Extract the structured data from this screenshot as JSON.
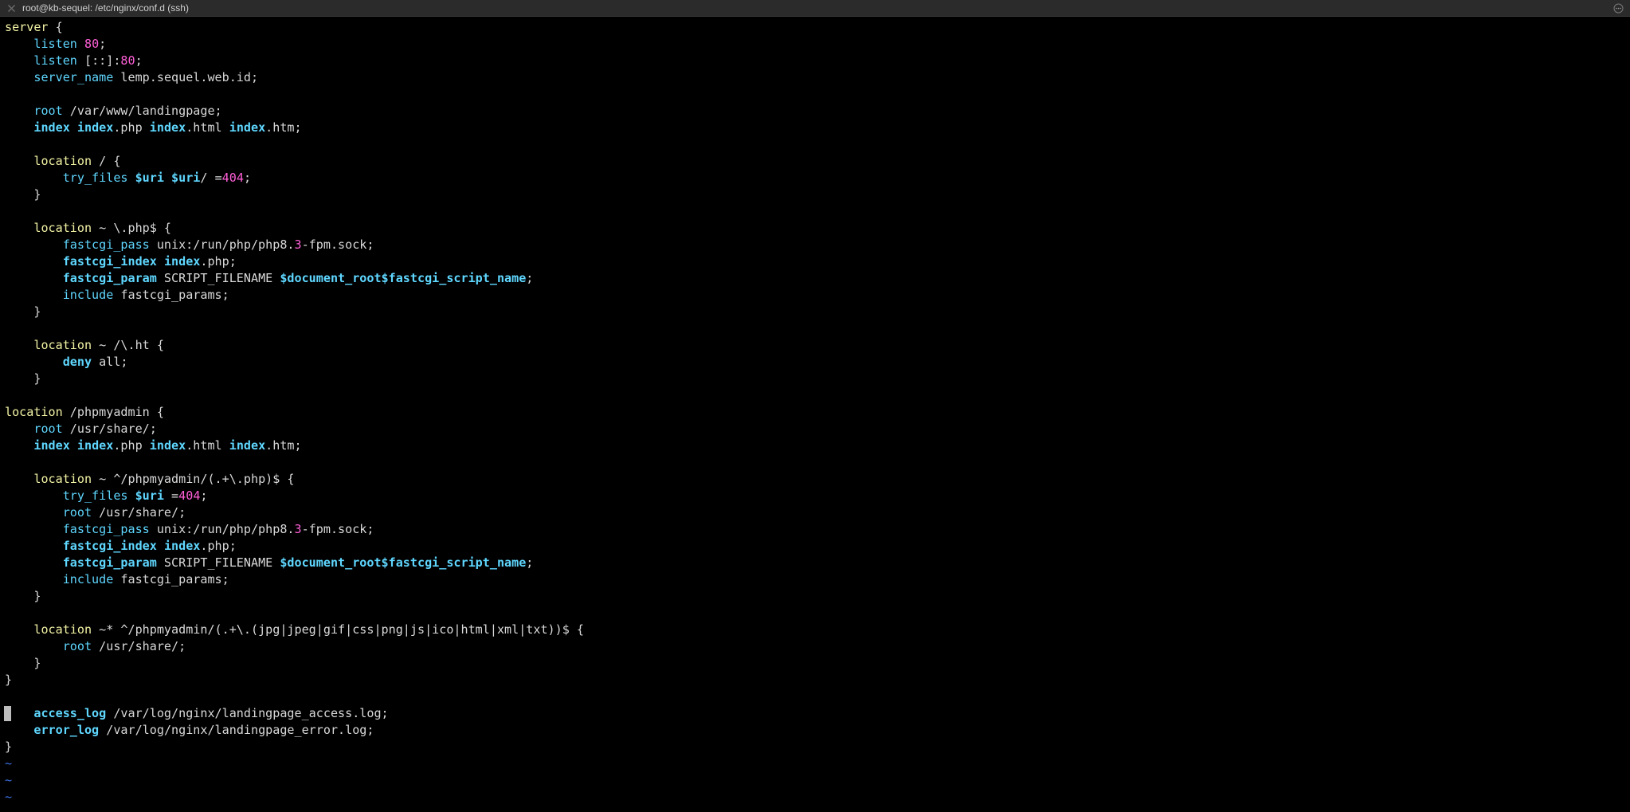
{
  "window": {
    "title": "root@kb-sequel: /etc/nginx/conf.d (ssh)"
  },
  "colors": {
    "background": "#000000",
    "block_keyword": "#f3f3a5",
    "directive": "#5fd7ff",
    "number": "#ff5fd7",
    "text": "#d9d9d9",
    "tilde": "#3a6fe0"
  },
  "cursor": {
    "line": 41,
    "column": 1
  },
  "lines": [
    [
      [
        "block",
        "server"
      ],
      [
        "plain",
        " {"
      ]
    ],
    [
      [
        "plain",
        "    "
      ],
      [
        "dir",
        "listen"
      ],
      [
        "plain",
        " "
      ],
      [
        "num",
        "80"
      ],
      [
        "plain",
        ";"
      ]
    ],
    [
      [
        "plain",
        "    "
      ],
      [
        "dir",
        "listen"
      ],
      [
        "plain",
        " [::]:"
      ],
      [
        "num",
        "80"
      ],
      [
        "plain",
        ";"
      ]
    ],
    [
      [
        "plain",
        "    "
      ],
      [
        "dir",
        "server_name"
      ],
      [
        "plain",
        " lemp.sequel.web.id;"
      ]
    ],
    [],
    [
      [
        "plain",
        "    "
      ],
      [
        "dir",
        "root"
      ],
      [
        "plain",
        " /var/www/landingpage;"
      ]
    ],
    [
      [
        "plain",
        "    "
      ],
      [
        "bdir",
        "index"
      ],
      [
        "plain",
        " "
      ],
      [
        "bdir",
        "index"
      ],
      [
        "plain",
        ".php "
      ],
      [
        "bdir",
        "index"
      ],
      [
        "plain",
        ".html "
      ],
      [
        "bdir",
        "index"
      ],
      [
        "plain",
        ".htm;"
      ]
    ],
    [],
    [
      [
        "plain",
        "    "
      ],
      [
        "block",
        "location"
      ],
      [
        "plain",
        " / {"
      ]
    ],
    [
      [
        "plain",
        "        "
      ],
      [
        "dir",
        "try_files"
      ],
      [
        "plain",
        " "
      ],
      [
        "var",
        "$uri"
      ],
      [
        "plain",
        " "
      ],
      [
        "var",
        "$uri"
      ],
      [
        "plain",
        "/ ="
      ],
      [
        "num",
        "404"
      ],
      [
        "plain",
        ";"
      ]
    ],
    [
      [
        "plain",
        "    }"
      ]
    ],
    [],
    [
      [
        "plain",
        "    "
      ],
      [
        "block",
        "location"
      ],
      [
        "plain",
        " ~ \\.php$ {"
      ]
    ],
    [
      [
        "plain",
        "        "
      ],
      [
        "dir",
        "fastcgi_pass"
      ],
      [
        "plain",
        " unix:/run/php/php8."
      ],
      [
        "num",
        "3"
      ],
      [
        "plain",
        "-fpm.sock;"
      ]
    ],
    [
      [
        "plain",
        "        "
      ],
      [
        "bdir",
        "fastcgi_index"
      ],
      [
        "plain",
        " "
      ],
      [
        "bdir",
        "index"
      ],
      [
        "plain",
        ".php;"
      ]
    ],
    [
      [
        "plain",
        "        "
      ],
      [
        "bdir",
        "fastcgi_param"
      ],
      [
        "plain",
        " SCRIPT_FILENAME "
      ],
      [
        "var",
        "$document_root$fastcgi_script_name"
      ],
      [
        "plain",
        ";"
      ]
    ],
    [
      [
        "plain",
        "        "
      ],
      [
        "dir",
        "include"
      ],
      [
        "plain",
        " fastcgi_params;"
      ]
    ],
    [
      [
        "plain",
        "    }"
      ]
    ],
    [],
    [
      [
        "plain",
        "    "
      ],
      [
        "block",
        "location"
      ],
      [
        "plain",
        " ~ /\\.ht {"
      ]
    ],
    [
      [
        "plain",
        "        "
      ],
      [
        "bdir",
        "deny"
      ],
      [
        "plain",
        " all;"
      ]
    ],
    [
      [
        "plain",
        "    }"
      ]
    ],
    [],
    [
      [
        "block",
        "location"
      ],
      [
        "plain",
        " /phpmyadmin {"
      ]
    ],
    [
      [
        "plain",
        "    "
      ],
      [
        "dir",
        "root"
      ],
      [
        "plain",
        " /usr/share/;"
      ]
    ],
    [
      [
        "plain",
        "    "
      ],
      [
        "bdir",
        "index"
      ],
      [
        "plain",
        " "
      ],
      [
        "bdir",
        "index"
      ],
      [
        "plain",
        ".php "
      ],
      [
        "bdir",
        "index"
      ],
      [
        "plain",
        ".html "
      ],
      [
        "bdir",
        "index"
      ],
      [
        "plain",
        ".htm;"
      ]
    ],
    [],
    [
      [
        "plain",
        "    "
      ],
      [
        "block",
        "location"
      ],
      [
        "plain",
        " ~ ^/phpmyadmin/(.+\\.php)$ {"
      ]
    ],
    [
      [
        "plain",
        "        "
      ],
      [
        "dir",
        "try_files"
      ],
      [
        "plain",
        " "
      ],
      [
        "var",
        "$uri"
      ],
      [
        "plain",
        " ="
      ],
      [
        "num",
        "404"
      ],
      [
        "plain",
        ";"
      ]
    ],
    [
      [
        "plain",
        "        "
      ],
      [
        "dir",
        "root"
      ],
      [
        "plain",
        " /usr/share/;"
      ]
    ],
    [
      [
        "plain",
        "        "
      ],
      [
        "dir",
        "fastcgi_pass"
      ],
      [
        "plain",
        " unix:/run/php/php8."
      ],
      [
        "num",
        "3"
      ],
      [
        "plain",
        "-fpm.sock;"
      ]
    ],
    [
      [
        "plain",
        "        "
      ],
      [
        "bdir",
        "fastcgi_index"
      ],
      [
        "plain",
        " "
      ],
      [
        "bdir",
        "index"
      ],
      [
        "plain",
        ".php;"
      ]
    ],
    [
      [
        "plain",
        "        "
      ],
      [
        "bdir",
        "fastcgi_param"
      ],
      [
        "plain",
        " SCRIPT_FILENAME "
      ],
      [
        "var",
        "$document_root$fastcgi_script_name"
      ],
      [
        "plain",
        ";"
      ]
    ],
    [
      [
        "plain",
        "        "
      ],
      [
        "dir",
        "include"
      ],
      [
        "plain",
        " fastcgi_params;"
      ]
    ],
    [
      [
        "plain",
        "    }"
      ]
    ],
    [],
    [
      [
        "plain",
        "    "
      ],
      [
        "block",
        "location"
      ],
      [
        "plain",
        " ~* ^/phpmyadmin/(.+\\.(jpg|jpeg|gif|css|png|js|ico|html|xml|txt))$ {"
      ]
    ],
    [
      [
        "plain",
        "        "
      ],
      [
        "dir",
        "root"
      ],
      [
        "plain",
        " /usr/share/;"
      ]
    ],
    [
      [
        "plain",
        "    }"
      ]
    ],
    [
      [
        "plain",
        "}"
      ]
    ],
    [],
    [
      [
        "plain",
        "    "
      ],
      [
        "bdir",
        "access_log"
      ],
      [
        "plain",
        " /var/log/nginx/landingpage_access.log;"
      ]
    ],
    [
      [
        "plain",
        "    "
      ],
      [
        "bdir",
        "error_log"
      ],
      [
        "plain",
        " /var/log/nginx/landingpage_error.log;"
      ]
    ],
    [
      [
        "plain",
        "}"
      ]
    ],
    [
      [
        "tilde",
        "~"
      ]
    ],
    [
      [
        "tilde",
        "~"
      ]
    ],
    [
      [
        "tilde",
        "~"
      ]
    ]
  ]
}
